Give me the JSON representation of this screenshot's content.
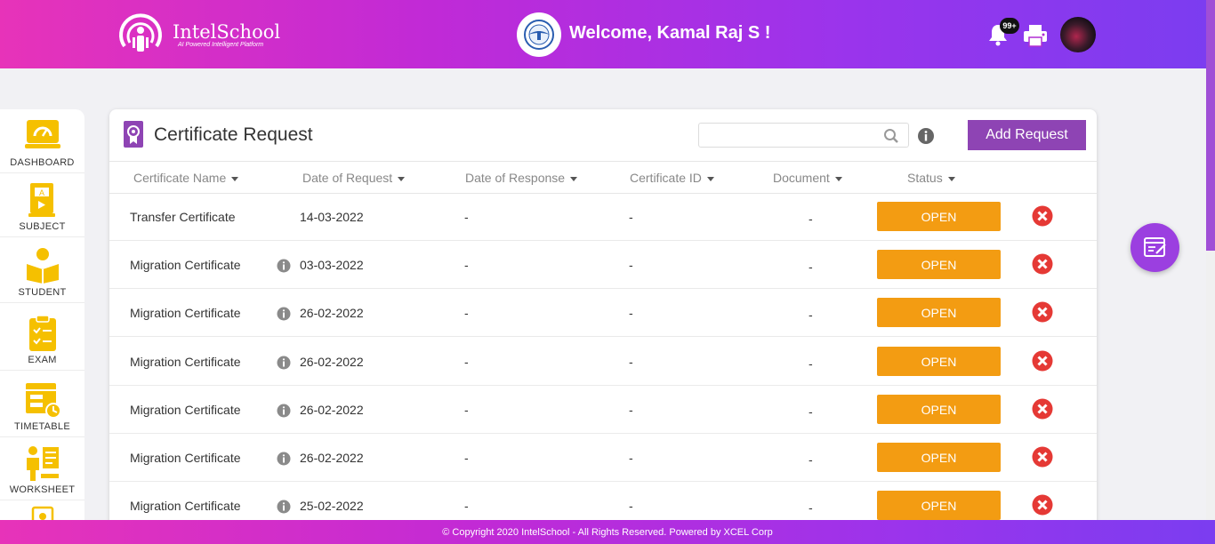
{
  "header": {
    "app_name": "IntelSchool",
    "tagline": "AI Powered Intelligent Platform",
    "welcome": "Welcome, Kamal Raj S !",
    "notification_count": "99+"
  },
  "sidebar": {
    "items": [
      {
        "label": "DASHBOARD",
        "icon": "dashboard-icon"
      },
      {
        "label": "SUBJECT",
        "icon": "subject-book-icon"
      },
      {
        "label": "STUDENT",
        "icon": "student-reading-icon"
      },
      {
        "label": "EXAM",
        "icon": "exam-clipboard-icon"
      },
      {
        "label": "TIMETABLE",
        "icon": "timetable-icon"
      },
      {
        "label": "WORKSHEET",
        "icon": "worksheet-icon"
      },
      {
        "label": "",
        "icon": "more-icon"
      }
    ]
  },
  "page": {
    "title": "Certificate Request",
    "search_value": "",
    "add_button": "Add Request"
  },
  "table": {
    "columns": [
      "Certificate Name",
      "Date of Request",
      "Date of Response",
      "Certificate ID",
      "Document",
      "Status"
    ],
    "rows": [
      {
        "name": "Transfer Certificate",
        "has_info": false,
        "date_request": "14-03-2022",
        "date_response": "-",
        "cert_id": "-",
        "document": "-",
        "status": "OPEN"
      },
      {
        "name": "Migration Certificate",
        "has_info": true,
        "date_request": "03-03-2022",
        "date_response": "-",
        "cert_id": "-",
        "document": "-",
        "status": "OPEN"
      },
      {
        "name": "Migration Certificate",
        "has_info": true,
        "date_request": "26-02-2022",
        "date_response": "-",
        "cert_id": "-",
        "document": "-",
        "status": "OPEN"
      },
      {
        "name": "Migration Certificate",
        "has_info": true,
        "date_request": "26-02-2022",
        "date_response": "-",
        "cert_id": "-",
        "document": "-",
        "status": "OPEN"
      },
      {
        "name": "Migration Certificate",
        "has_info": true,
        "date_request": "26-02-2022",
        "date_response": "-",
        "cert_id": "-",
        "document": "-",
        "status": "OPEN"
      },
      {
        "name": "Migration Certificate",
        "has_info": true,
        "date_request": "26-02-2022",
        "date_response": "-",
        "cert_id": "-",
        "document": "-",
        "status": "OPEN"
      },
      {
        "name": "Migration Certificate",
        "has_info": true,
        "date_request": "25-02-2022",
        "date_response": "-",
        "cert_id": "-",
        "document": "-",
        "status": "OPEN"
      }
    ]
  },
  "footer": {
    "copyright": "© Copyright 2020 IntelSchool - All Rights Reserved. Powered by XCEL Corp"
  },
  "colors": {
    "accent_purple": "#8e44b4",
    "status_orange": "#f39c12",
    "delete_red": "#e53935",
    "icon_yellow": "#f5c000"
  }
}
